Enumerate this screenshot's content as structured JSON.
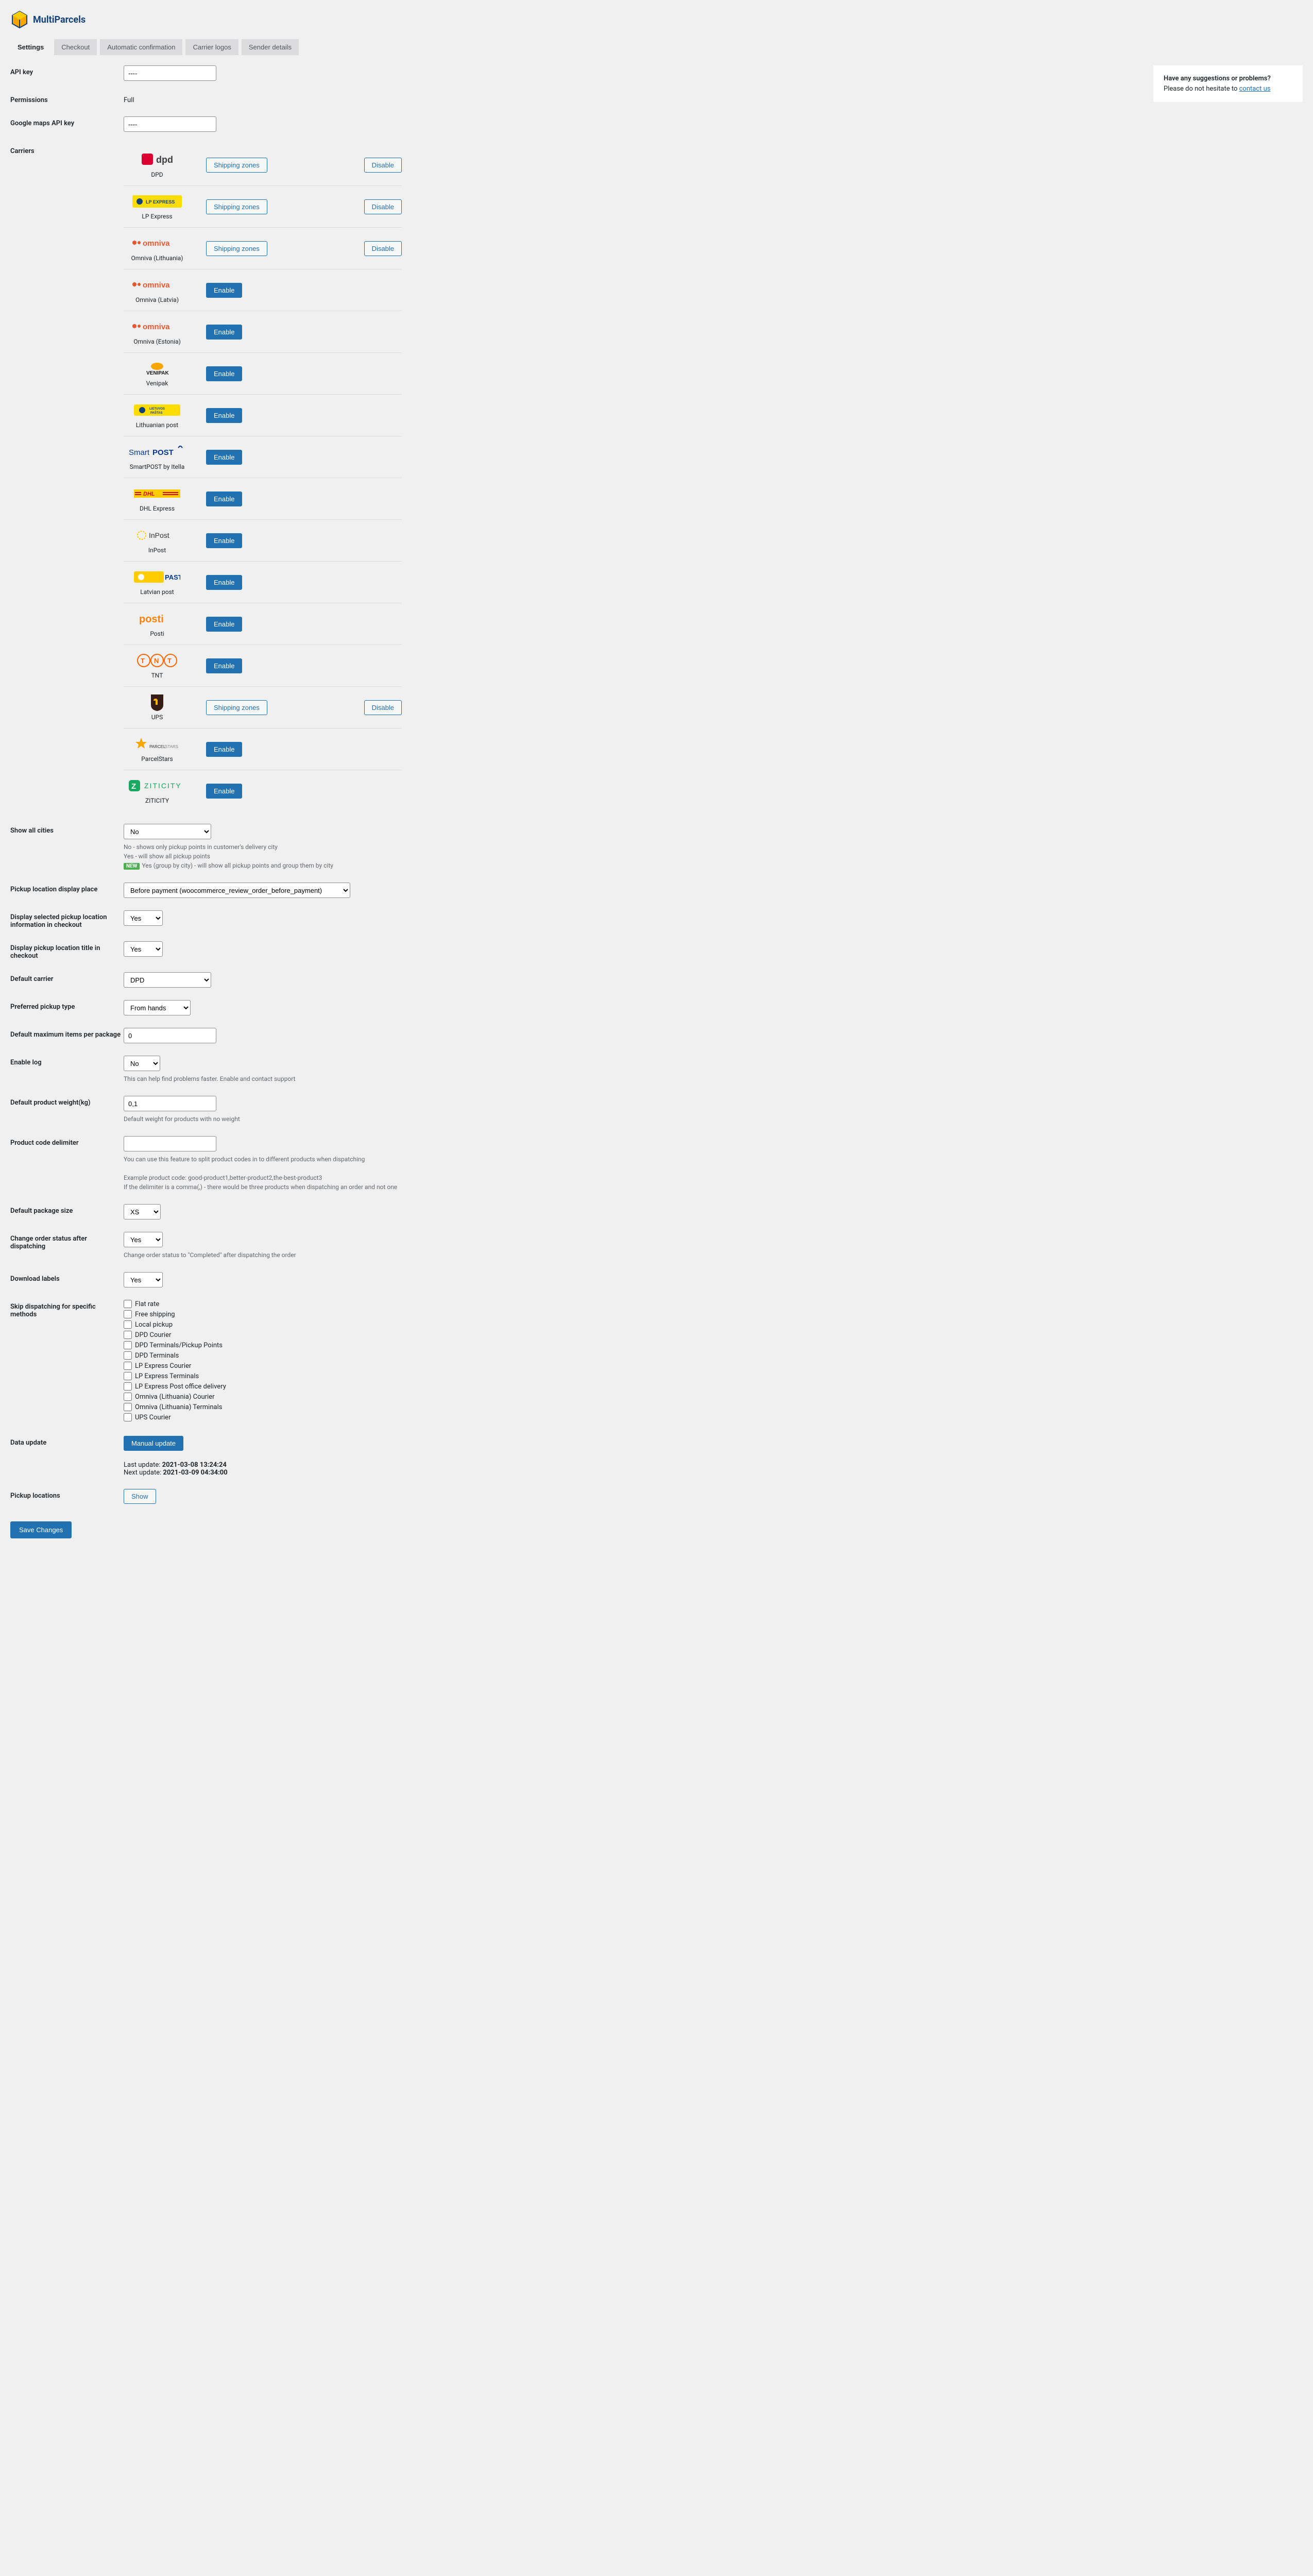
{
  "brand": "MultiParcels",
  "tabs": [
    "Settings",
    "Checkout",
    "Automatic confirmation",
    "Carrier logos",
    "Sender details"
  ],
  "suggest": {
    "title": "Have any suggestions or problems?",
    "text": "Please do not hesitate to ",
    "link": "contact us"
  },
  "labels": {
    "api_key": "API key",
    "permissions": "Permissions",
    "gmaps": "Google maps API key",
    "carriers": "Carriers",
    "show_all_cities": "Show all cities",
    "pickup_display": "Pickup location display place",
    "display_selected": "Display selected pickup location information in checkout",
    "display_title": "Display pickup location title in checkout",
    "default_carrier": "Default carrier",
    "preferred_pickup": "Preferred pickup type",
    "max_items": "Default maximum items per package",
    "enable_log": "Enable log",
    "default_weight": "Default product weight(kg)",
    "code_delimiter": "Product code delimiter",
    "package_size": "Default package size",
    "change_status": "Change order status after dispatching",
    "download_labels": "Download labels",
    "skip_dispatch": "Skip dispatching for specific methods",
    "data_update": "Data update",
    "pickup_locations": "Pickup locations",
    "save": "Save Changes"
  },
  "values": {
    "api_key": "----",
    "permissions": "Full",
    "gmaps": "----",
    "show_all_cities": "No",
    "pickup_display": "Before payment (woocommerce_review_order_before_payment)",
    "display_selected": "Yes",
    "display_title": "Yes",
    "default_carrier": "DPD",
    "preferred_pickup": "From hands",
    "max_items": "0",
    "enable_log": "No",
    "default_weight": "0,1",
    "code_delimiter": "",
    "package_size": "XS",
    "change_status": "Yes",
    "download_labels": "Yes"
  },
  "desc": {
    "cities_no": "No - shows only pickup points in customer's delivery city",
    "cities_yes": "Yes - will show all pickup points",
    "cities_group": "Yes (group by city) - will show all pickup points and group them by city",
    "log": "This can help find problems faster. Enable and contact support",
    "weight": "Default weight for products with no weight",
    "delim1": "You can use this feature to split product codes in to different products when dispatching",
    "delim2": "Example product code: good-product1,better-product2,the-best-product3",
    "delim3": "If the delimiter is a comma(,) - there would be three products when dispatching an order and not one",
    "status": "Change order status to \"Completed\" after dispatching the order",
    "last_update": "Last update: ",
    "last_update_val": "2021-03-08 13:24:24",
    "next_update": "Next update: ",
    "next_update_val": "2021-03-09 04:34:00"
  },
  "buttons": {
    "shipping_zones": "Shipping zones",
    "disable": "Disable",
    "enable": "Enable",
    "manual_update": "Manual update",
    "show": "Show"
  },
  "carriers": [
    {
      "name": "DPD",
      "enabled": true
    },
    {
      "name": "LP Express",
      "enabled": true
    },
    {
      "name": "Omniva (Lithuania)",
      "enabled": true
    },
    {
      "name": "Omniva (Latvia)",
      "enabled": false
    },
    {
      "name": "Omniva (Estonia)",
      "enabled": false
    },
    {
      "name": "Venipak",
      "enabled": false
    },
    {
      "name": "Lithuanian post",
      "enabled": false
    },
    {
      "name": "SmartPOST by Itella",
      "enabled": false
    },
    {
      "name": "DHL Express",
      "enabled": false
    },
    {
      "name": "InPost",
      "enabled": false
    },
    {
      "name": "Latvian post",
      "enabled": false
    },
    {
      "name": "Posti",
      "enabled": false
    },
    {
      "name": "TNT",
      "enabled": false
    },
    {
      "name": "UPS",
      "enabled": true
    },
    {
      "name": "ParcelStars",
      "enabled": false
    },
    {
      "name": "ZITICITY",
      "enabled": false
    }
  ],
  "skip_methods": [
    "Flat rate",
    "Free shipping",
    "Local pickup",
    "DPD Courier",
    "DPD Terminals/Pickup Points",
    "DPD Terminals",
    "LP Express Courier",
    "LP Express Terminals",
    "LP Express Post office delivery",
    "Omniva (Lithuania) Courier",
    "Omniva (Lithuania) Terminals",
    "UPS Courier"
  ],
  "carrier_logos": {
    "DPD": "<svg width='60' height='28' viewBox='0 0 60 28'><rect x='0' y='2' width='22' height='22' rx='4' fill='#dc0032'/><text x='28' y='20' font-family='Arial' font-size='18' font-weight='700' fill='#414042'>dpd</text></svg>",
    "LP Express": "<svg width='96' height='24' viewBox='0 0 96 24'><rect width='96' height='24' rx='3' fill='#ffdd00'/><circle cx='14' cy='12' r='6' fill='#13427a'/><text x='26' y='16' font-family='Arial' font-size='9' font-weight='700' fill='#13427a'>LP EXPRESS</text></svg>",
    "Omniva (Lithuania)": "<svg width='100' height='22'><text x='22' y='16' font-family='Arial' font-size='15' font-weight='700' fill='#e8582c'>omniva</text><circle cx='6' cy='10' r='4' fill='#e8582c'/><circle cx='15' cy='10' r='3' fill='#e8582c'/></svg>",
    "Omniva (Latvia)": "<svg width='100' height='22'><text x='22' y='16' font-family='Arial' font-size='15' font-weight='700' fill='#e8582c'>omniva</text><circle cx='6' cy='10' r='4' fill='#e8582c'/><circle cx='15' cy='10' r='3' fill='#e8582c'/></svg>",
    "Omniva (Estonia)": "<svg width='100' height='22'><text x='22' y='16' font-family='Arial' font-size='15' font-weight='700' fill='#e8582c'>omniva</text><circle cx='6' cy='10' r='4' fill='#e8582c'/><circle cx='15' cy='10' r='3' fill='#e8582c'/></svg>",
    "Venipak": "<svg width='70' height='28'><ellipse cx='35' cy='10' rx='12' ry='7' fill='#f7a600'/><text x='14' y='26' font-family='Arial' font-size='10' font-weight='700' fill='#1a1a1a'>VENIPAK</text></svg>",
    "Lithuanian post": "<svg width='90' height='22'><rect width='90' height='22' rx='3' fill='#ffdd00'/><text x='30' y='10' font-family='Arial' font-size='6' font-weight='700' fill='#13427a'>LIETUVOS</text><text x='32' y='18' font-family='Arial' font-size='6' font-weight='700' fill='#13427a'>PAŠTAS</text><circle cx='16' cy='11' r='6' fill='#13427a'/></svg>",
    "SmartPOST by Itella": "<svg width='110' height='24'><text x='0' y='18' font-family='Arial' font-size='15' font-weight='400' fill='#003893'>Smart</text><text x='46' y='18' font-family='Arial' font-size='15' font-weight='700' fill='#003893'>POST</text><path d='M96 4 L100 0 L104 4' stroke='#003893' stroke-width='2' fill='none'/></svg>",
    "DHL Express": "<svg width='90' height='16'><rect width='90' height='16' fill='#ffcc00'/><text x='18' y='12' font-family='Arial' font-size='11' font-weight='700' font-style='italic' fill='#d40511'>DHL</text><rect x='2' y='5' width='12' height='2' fill='#d40511'/><rect x='2' y='9' width='12' height='2' fill='#d40511'/><rect x='56' y='5' width='30' height='2' fill='#d40511'/><rect x='56' y='9' width='30' height='2' fill='#d40511'/></svg>",
    "InPost": "<svg width='80' height='24'><circle cx='10' cy='12' r='8' fill='none' stroke='#ffcc00' stroke-width='2' stroke-dasharray='3 2'/><text x='24' y='17' font-family='Arial' font-size='14' font-weight='400' fill='#333'>InPost</text></svg>",
    "Latvian post": "<svg width='90' height='22'><rect width='58' height='22' rx='3' fill='#ffcc00'/><circle cx='14' cy='11' r='6' fill='#fff'/><text x='60' y='16' font-family='Arial' font-size='13' font-weight='700' fill='#003893'>PASTS</text></svg>",
    "Posti": "<svg width='70' height='26'><text x='0' y='20' font-family='Arial' font-size='20' font-weight='700' fill='#ff8200'>posti</text></svg>",
    "TNT": "<svg width='80' height='28'><circle cx='14' cy='14' r='12' fill='none' stroke='#ff6600' stroke-width='2'/><text x='8' y='19' font-family='Arial' font-size='13' font-weight='700' fill='#ff6600'>T</text><circle cx='40' cy='14' r='12' fill='none' stroke='#ff6600' stroke-width='2'/><text x='34' y='19' font-family='Arial' font-size='13' font-weight='700' fill='#ff6600'>N</text><circle cx='66' cy='14' r='12' fill='none' stroke='#ff6600' stroke-width='2'/><text x='60' y='19' font-family='Arial' font-size='13' font-weight='700' fill='#ff6600'>T</text></svg>",
    "UPS": "<svg width='30' height='34'><path d='M3 2 H27 V22 Q27 32 15 34 Q3 32 3 22 Z' fill='#351c15'/><path d='M8 14 Q8 10 12 10 Q16 10 16 14 V22 H12 V14' fill='#ffb500'/></svg>",
    "ParcelStars": "<svg width='90' height='28'><polygon points='14,2 17,10 25,10 19,15 21,23 14,18 7,23 9,15 3,10 11,10' fill='#f7a600'/><text x='30' y='22' font-family='Arial' font-size='8' font-weight='400' fill='#333'>PARCEL</text><text x='60' y='22' font-family='Arial' font-size='8' font-weight='300' fill='#888'>STARS</text></svg>",
    "ZITICITY": "<svg width='110' height='26'><rect x='0' y='2' width='22' height='22' rx='5' fill='#18a860'/><text x='5' y='19' font-family='Arial' font-size='15' font-weight='700' fill='#fff'>Z</text><text x='30' y='18' font-family='Arial' font-size='14' font-weight='400' fill='#18a860' letter-spacing='2'>ZITICITY</text></svg>"
  }
}
